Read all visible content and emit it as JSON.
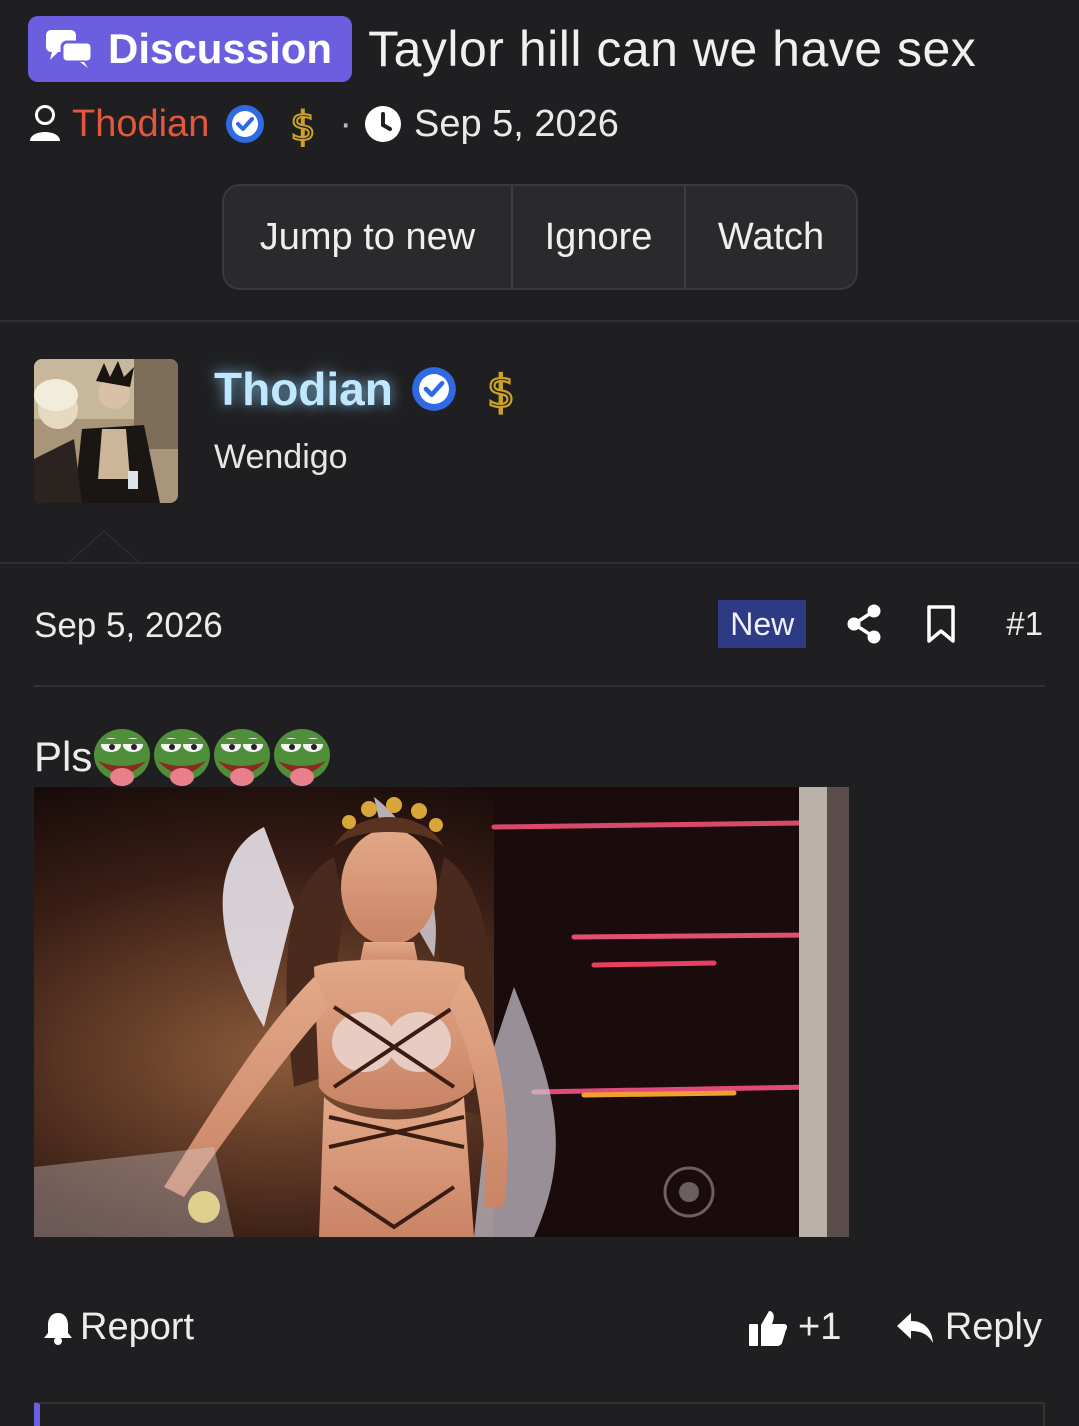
{
  "thread": {
    "prefix": "Discussion",
    "title": "Taylor hill can we have sex",
    "author": "Thodian",
    "separator": "·",
    "date": "Sep 5, 2026"
  },
  "thread_buttons": [
    "Jump to new",
    "Ignore",
    "Watch"
  ],
  "user": {
    "name": "Thodian",
    "title": "Wendigo"
  },
  "post": {
    "date": "Sep 5, 2026",
    "new_badge": "New",
    "number": "#1",
    "text": "Pls",
    "emoji_count": 4
  },
  "footer": {
    "report": "Report",
    "like": "+1",
    "reply": "Reply"
  },
  "colors": {
    "prefix_bg": "#6b5fe0",
    "author_link": "#e3573c",
    "verified": "#2f6ae3",
    "dollar": "#c9a227",
    "username_glow": "#bfe8ff",
    "new_badge_bg": "#2d3b85"
  },
  "icons": [
    "discussion-icon",
    "user-icon",
    "verified-icon",
    "dollar-icon",
    "clock-icon",
    "share-icon",
    "bookmark-icon",
    "bell-icon",
    "thumbs-up-icon",
    "reply-icon"
  ]
}
